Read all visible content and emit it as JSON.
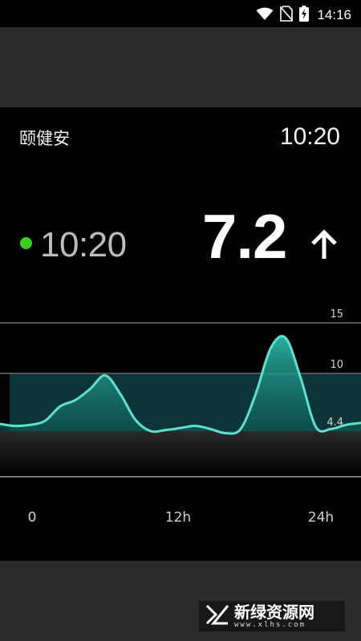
{
  "status_bar": {
    "time": "14:16",
    "icons": [
      "wifi-icon",
      "no-sim-icon",
      "battery-charging-icon"
    ]
  },
  "header": {
    "app_name": "颐健安",
    "time": "10:20"
  },
  "reading": {
    "time": "10:20",
    "value": "7.2",
    "trend": "up-arrow-icon",
    "status_dot_color": "#3bd01f"
  },
  "chart_data": {
    "type": "area",
    "x_tick_labels": [
      "0",
      "12h",
      "24h"
    ],
    "y_tick_labels": [
      "15",
      "10",
      "4.4"
    ],
    "target_range": [
      4.4,
      10
    ],
    "xlim": [
      0,
      24
    ],
    "x": [
      0,
      1,
      2,
      3,
      4,
      5,
      6,
      7,
      8,
      9,
      10,
      11,
      12,
      13,
      14,
      15,
      16,
      17,
      18,
      19,
      20,
      21,
      22,
      23,
      24
    ],
    "series": [
      {
        "values": [
          5.1,
          4.9,
          5.0,
          5.4,
          6.8,
          7.4,
          8.5,
          9.8,
          8.0,
          5.5,
          4.4,
          4.5,
          4.7,
          4.9,
          4.6,
          4.2,
          4.6,
          8.0,
          12.5,
          13.5,
          9.5,
          4.8,
          4.6,
          5.0,
          5.2
        ]
      }
    ],
    "colors": {
      "line": "#5fe0cf",
      "fill": "#2bb8a6",
      "band": "#0b3538"
    }
  },
  "watermark": {
    "name": "新绿资源网",
    "url": "www.xlhs.com"
  }
}
